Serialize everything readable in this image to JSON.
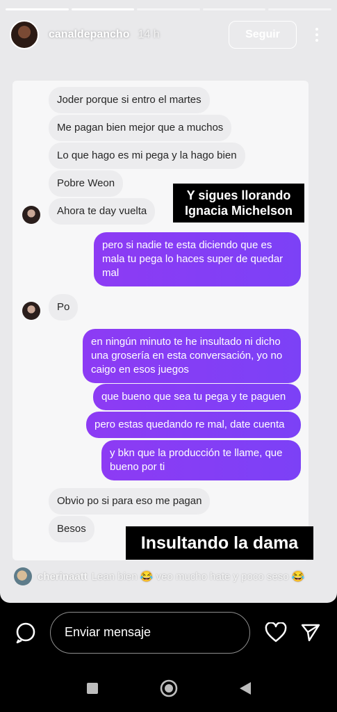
{
  "story": {
    "username": "canaldepancho",
    "time": "14 h",
    "follow_label": "Seguir",
    "progress_segments": 5,
    "active_segment": 2
  },
  "chat": {
    "incoming_1": [
      "Joder porque si entro el martes",
      "Me pagan bien mejor que a muchos",
      "Lo que hago es mi pega y la hago bien",
      "Pobre Weon",
      "Ahora te day vuelta"
    ],
    "outgoing_1": "pero si nadie te esta diciendo que es mala tu pega lo haces super de quedar mal",
    "incoming_2": "Po",
    "outgoing_2": [
      "en ningún minuto te he insultado ni dicho una grosería en esta conversación, yo no caigo en esos juegos",
      "que bueno que sea tu pega y te paguen",
      "pero estas quedando re mal, date cuenta",
      "y bkn que la producción te llame, que bueno por ti"
    ],
    "incoming_3": [
      "Obvio po si para eso me pagan",
      "Besos"
    ]
  },
  "captions": {
    "top": [
      "Y sigues llorando",
      "Ignacia Michelson"
    ],
    "bottom": "Insultando la dama"
  },
  "comment": {
    "user": "cherinaatt",
    "text": "Lean bien 😂 veo mucho hate y poco seso 😂"
  },
  "reply": {
    "placeholder": "Enviar mensaje"
  },
  "colors": {
    "outgoing_bubble": "#8b3cf2",
    "incoming_bubble": "#ececee",
    "caption_bg": "#000000"
  }
}
